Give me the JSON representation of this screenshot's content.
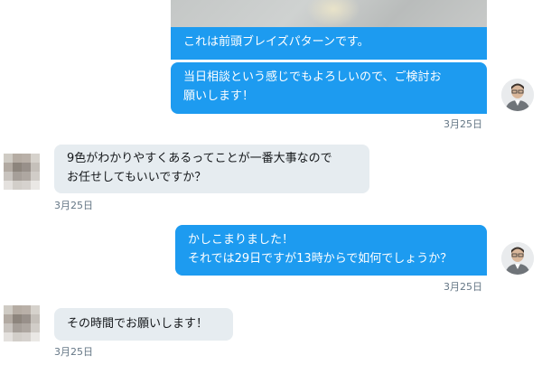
{
  "messages": [
    {
      "from": "me",
      "text": "これは前頭ブレイズパターンです。"
    },
    {
      "from": "me",
      "text": "当日相談という感じでもよろしいので、ご検討お\n願いします！",
      "time": "3月25日"
    },
    {
      "from": "other",
      "text": "9色がわかりやすくあるってことが一番大事なので\nお任せしてもいいですか？",
      "time": "3月25日"
    },
    {
      "from": "me",
      "text": "かしこまりました！\nそれでは29日ですが13時からで如何でしょうか？",
      "time": "3月25日"
    },
    {
      "from": "other",
      "text": "その時間でお願いします！",
      "time": "3月25日"
    }
  ],
  "colors": {
    "outgoing_bubble": "#1d9bf0",
    "incoming_bubble": "#e6ecf0",
    "timestamp": "#657786"
  }
}
